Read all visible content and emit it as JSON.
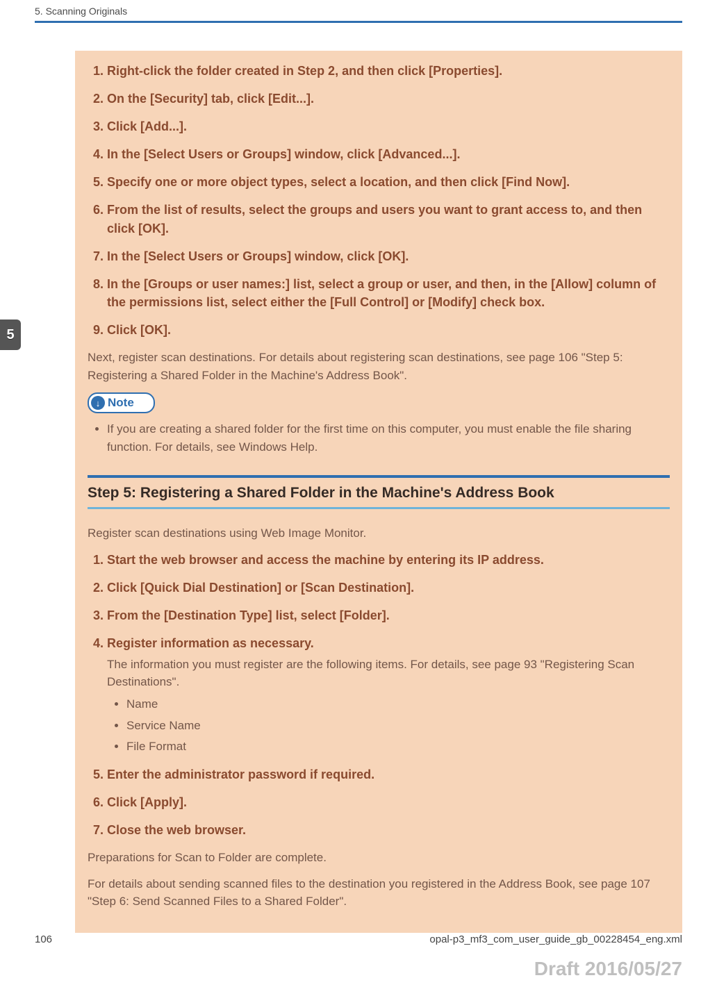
{
  "header": {
    "running_head": "5. Scanning Originals",
    "chapter_tab": "5"
  },
  "block1": {
    "steps": [
      "Right-click the folder created in Step 2, and then click [Properties].",
      "On the [Security] tab, click [Edit...].",
      "Click [Add...].",
      "In the [Select Users or Groups] window, click [Advanced...].",
      "Specify one or more object types, select a location, and then click [Find Now].",
      "From the list of results, select the groups and users you want to grant access to, and then click [OK].",
      "In the [Select Users or Groups] window, click [OK].",
      "In the [Groups or user names:] list, select a group or user, and then, in the [Allow] column of the permissions list, select either the [Full Control] or [Modify] check box.",
      "Click [OK]."
    ],
    "after_para": "Next, register scan destinations. For details about registering scan destinations, see page 106 \"Step 5: Registering a Shared Folder in the Machine's Address Book\".",
    "note_label": "Note",
    "note_items": [
      "If you are creating a shared folder for the first time on this computer, you must enable the file sharing function. For details, see Windows Help."
    ]
  },
  "section": {
    "title": "Step 5: Registering a Shared Folder in the Machine's Address Book",
    "intro": "Register scan destinations using Web Image Monitor.",
    "steps": [
      {
        "main": "Start the web browser and access the machine by entering its IP address."
      },
      {
        "main": "Click [Quick Dial Destination] or [Scan Destination]."
      },
      {
        "main": "From the [Destination Type] list, select [Folder]."
      },
      {
        "main": "Register information as necessary.",
        "sub": "The information you must register are the following items. For details, see page 93 \"Registering Scan Destinations\".",
        "bullets": [
          "Name",
          "Service Name",
          "File Format"
        ]
      },
      {
        "main": "Enter the administrator password if required."
      },
      {
        "main": "Click [Apply]."
      },
      {
        "main": "Close the web browser."
      }
    ],
    "outro1": "Preparations for Scan to Folder are complete.",
    "outro2": "For details about sending scanned files to the destination you registered in the Address Book, see page 107 \"Step 6: Send Scanned Files to a Shared Folder\"."
  },
  "footer": {
    "page_number": "106",
    "source_file": "opal-p3_mf3_com_user_guide_gb_00228454_eng.xml",
    "draft_stamp": "Draft 2016/05/27"
  }
}
